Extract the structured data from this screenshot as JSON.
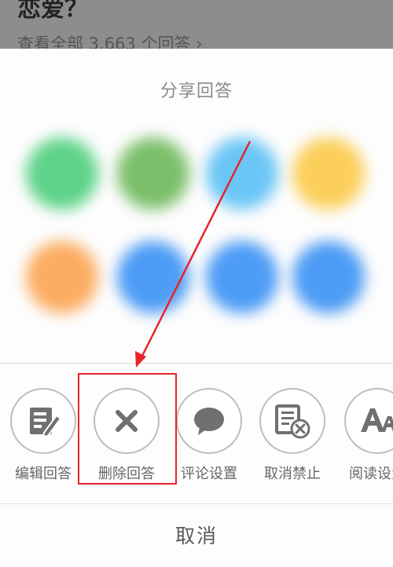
{
  "background": {
    "question_title": "恋爱？",
    "view_all_link": "查看全部 3,663 个回答 ›"
  },
  "sheet": {
    "share_title": "分享回答",
    "share_targets": [
      {
        "icon": "green-share-icon",
        "color": "#5fd38a"
      },
      {
        "icon": "green-share-icon",
        "color": "#7bbf6a"
      },
      {
        "icon": "light-blue-share-icon",
        "color": "#6cc6f5"
      },
      {
        "icon": "yellow-share-icon",
        "color": "#fbcf5a"
      },
      {
        "icon": "orange-share-icon",
        "color": "#fbad62"
      },
      {
        "icon": "blue-share-icon",
        "color": "#4d9cf5"
      },
      {
        "icon": "blue-share-icon",
        "color": "#4d9cf5"
      },
      {
        "icon": "blue-share-icon",
        "color": "#4d9cf5"
      }
    ],
    "actions": [
      {
        "label": "编辑回答",
        "icon": "edit-icon"
      },
      {
        "label": "删除回答",
        "icon": "close-icon"
      },
      {
        "label": "评论设置",
        "icon": "comment-icon"
      },
      {
        "label": "取消禁止",
        "icon": "unban-icon"
      },
      {
        "label": "阅读设置",
        "icon": "font-icon"
      }
    ],
    "cancel_label": "取消"
  },
  "annotation": {
    "highlight_color": "#e8232a"
  }
}
